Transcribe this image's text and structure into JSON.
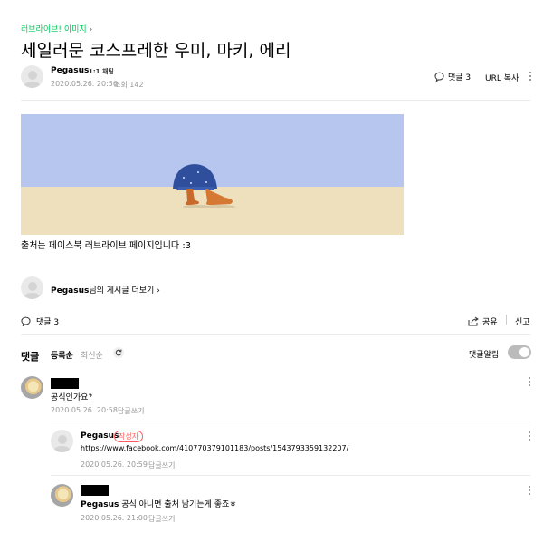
{
  "breadcrumb": "러브라이브! 이미지",
  "title": "세일러문 코스프레한 우미, 마키, 에리",
  "author": {
    "name": "Pegasus",
    "chat_badge": "1:1 채팅",
    "date": "2020.05.26. 20:56",
    "views": "조회 142"
  },
  "header_actions": {
    "comments": "댓글 3",
    "url_copy": "URL 복사"
  },
  "post": {
    "body_text": "출처는 페이스북 러브라이브 페이지입니다 :3",
    "image_alt": "sailor moon cosplay shoes on beach"
  },
  "more_posts": {
    "name": "Pegasus",
    "suffix": "님의 게시글 더보기"
  },
  "footer_bar": {
    "comments": "댓글 3",
    "share": "공유",
    "report": "신고"
  },
  "comments_section": {
    "title": "댓글",
    "sort_registered": "등록순",
    "sort_latest": "최신순",
    "alarm_label": "댓글알림"
  },
  "comments": [
    {
      "text": "공식인가요?",
      "date": "2020.05.26. 20:58",
      "reply_label": "답글쓰기"
    },
    {
      "author": "Pegasus",
      "badge": "작성자",
      "text": "https://www.facebook.com/410770379101183/posts/1543793359132207/",
      "date": "2020.05.26. 20:59",
      "reply_label": "답글쓰기"
    },
    {
      "mention": "Pegasus",
      "text": "공식 아니면 출처 남기는게 좋죠ㅎ",
      "date": "2020.05.26. 21:00",
      "reply_label": "답글쓰기"
    }
  ],
  "colors": {
    "accent": "#03c75a",
    "sky": "#b7c6ee",
    "sand": "#eee0bd",
    "badge": "#ff5c5c"
  }
}
